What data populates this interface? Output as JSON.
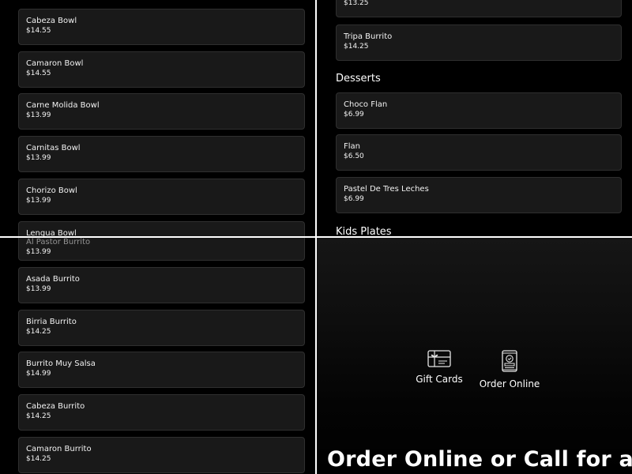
{
  "left_top_items": [
    {
      "name": "Cabeza Bowl",
      "price": "$14.55"
    },
    {
      "name": "Camaron Bowl",
      "price": "$14.55"
    },
    {
      "name": "Carne Molida Bowl",
      "price": "$13.99"
    },
    {
      "name": "Carnitas Bowl",
      "price": "$13.99"
    },
    {
      "name": "Chorizo Bowl",
      "price": "$13.99"
    }
  ],
  "left_top_partial": {
    "name": "Lengua Bowl"
  },
  "right_top_partial": {
    "price": "$13.25"
  },
  "right_top_items": [
    {
      "name": "Tripa Burrito",
      "price": "$14.25"
    }
  ],
  "desserts": {
    "heading": "Desserts",
    "items": [
      {
        "name": "Choco Flan",
        "price": "$6.99"
      },
      {
        "name": "Flan",
        "price": "$6.50"
      },
      {
        "name": "Pastel De Tres Leches",
        "price": "$6.99"
      }
    ]
  },
  "kids_heading": "Kids Plates",
  "left_bottom_partial": {
    "name": "Al Pastor Burrito",
    "price": "$13.99"
  },
  "left_bottom_items": [
    {
      "name": "Asada Burrito",
      "price": "$13.99"
    },
    {
      "name": "Birria Burrito",
      "price": "$14.25"
    },
    {
      "name": "Burrito Muy Salsa",
      "price": "$14.99"
    },
    {
      "name": "Cabeza Burrito",
      "price": "$14.25"
    },
    {
      "name": "Camaron Burrito",
      "price": "$14.25"
    }
  ],
  "actions": {
    "gift_cards": "Gift Cards",
    "order_online": "Order Online"
  },
  "cta_text": "Order Online or Call for a",
  "icons": {
    "gift_cards": "gift-card-icon",
    "order_online": "mobile-order-icon"
  }
}
